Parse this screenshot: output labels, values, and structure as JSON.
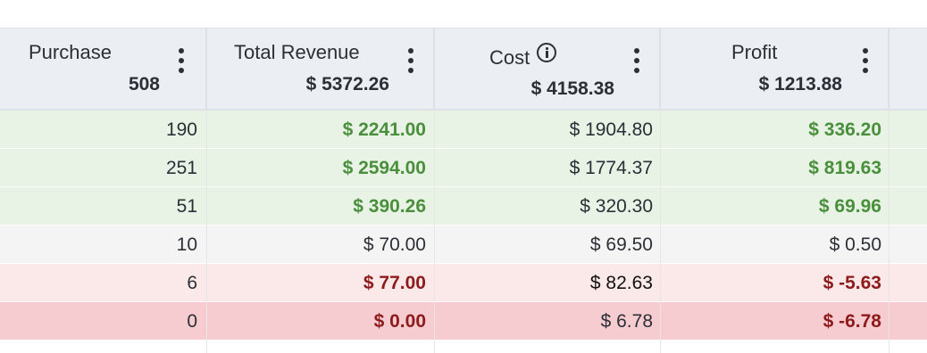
{
  "columns": [
    {
      "title": "Purchase",
      "total": "508"
    },
    {
      "title": "Total Revenue",
      "total": "$ 5372.26"
    },
    {
      "title": "Cost",
      "total": "$ 4158.38",
      "icon": "info-icon"
    },
    {
      "title": "Profit",
      "total": "$ 1213.88"
    }
  ],
  "menu_icon": "kebab-menu-icon",
  "rows": [
    {
      "status": "profit",
      "purchase": "190",
      "revenue": "$ 2241.00",
      "cost": "$ 1904.80",
      "profit": "$ 336.20"
    },
    {
      "status": "profit",
      "purchase": "251",
      "revenue": "$ 2594.00",
      "cost": "$ 1774.37",
      "profit": "$ 819.63"
    },
    {
      "status": "profit",
      "purchase": "51",
      "revenue": "$ 390.26",
      "cost": "$ 320.30",
      "profit": "$ 69.96"
    },
    {
      "status": "neutral",
      "purchase": "10",
      "revenue": "$ 70.00",
      "cost": "$ 69.50",
      "profit": "$ 0.50"
    },
    {
      "status": "loss",
      "purchase": "6",
      "revenue": "$ 77.00",
      "cost": "$ 82.63",
      "profit": "$ -5.63"
    },
    {
      "status": "bigloss",
      "purchase": "0",
      "revenue": "$ 0.00",
      "cost": "$ 6.78",
      "profit": "$ -6.78"
    }
  ],
  "colors": {
    "header_bg": "#ebeef2",
    "profit_row_bg": "#e8f3e6",
    "neutral_row_bg": "#f4f4f4",
    "loss_row_bg": "#fbe9ea",
    "big_loss_row_bg": "#f6ccd1",
    "positive_text": "#4a8f3c",
    "negative_text": "#8e1b1b"
  }
}
